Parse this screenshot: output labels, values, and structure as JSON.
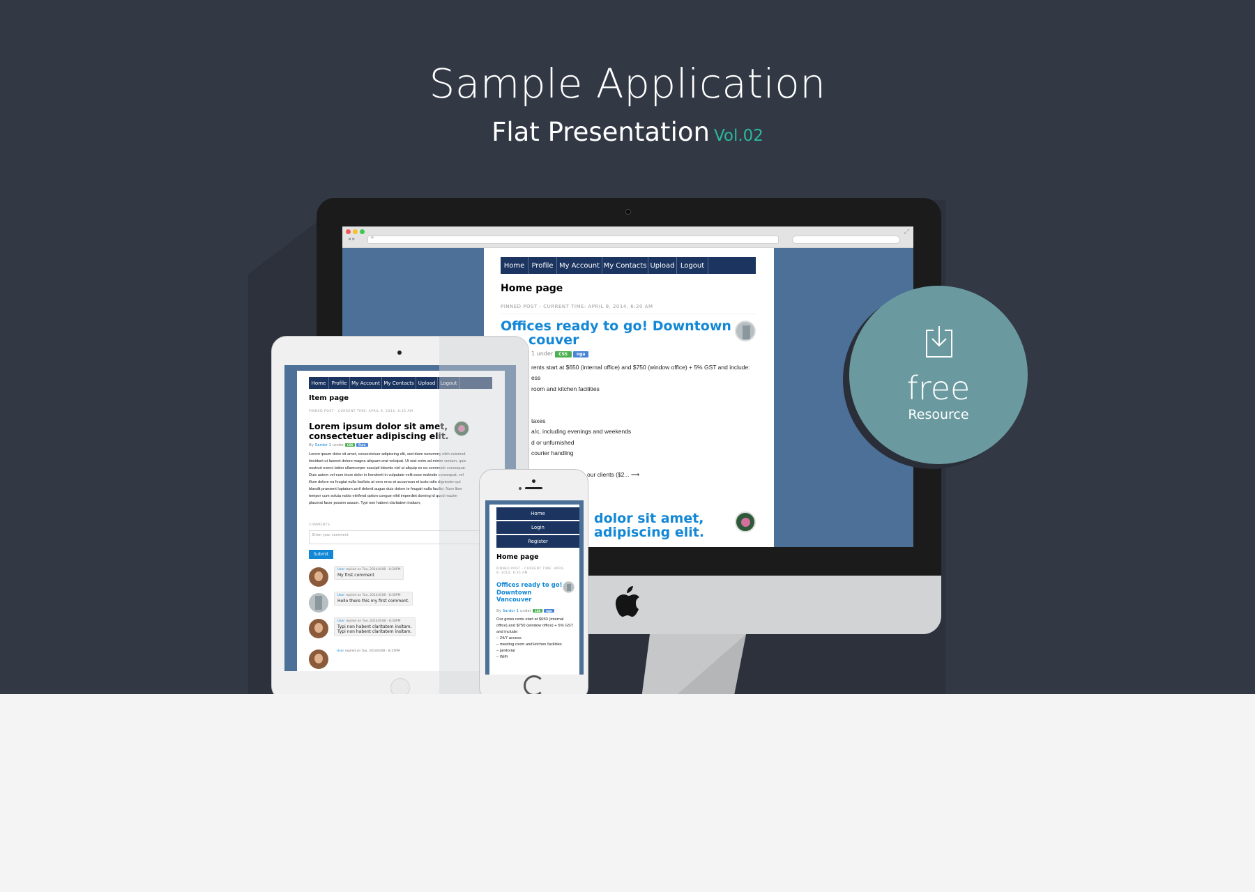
{
  "hero": {
    "title": "Sample Application",
    "subtitle": "Flat Presentation",
    "vol": "Vol.02"
  },
  "badge": {
    "free": "free",
    "resource": "Resource"
  },
  "desktop": {
    "nav": [
      "Home",
      "Profile",
      "My Account",
      "My Contacts",
      "Upload",
      "Logout"
    ],
    "page_title": "Home page",
    "meta": "PINNED POST - CURRENT TIME: APRIL 9, 2014, 6:20 AM",
    "post1": {
      "title_line1": "Offices ready to go! Downtown",
      "title_line2": "couver",
      "byline": "1 under",
      "tags": [
        "CSS",
        "nga"
      ],
      "lines": [
        "rents start at $650 (internal office) and $750 (window office) + 5% GST and include:",
        "ess",
        "room and kitchen facilities",
        "taxes",
        "a/c, including evenings and weekends",
        "d or unfurnished",
        "courier handling",
        "our clients ($2... ⟶"
      ]
    },
    "post2": {
      "title_line1": "dolor sit amet,",
      "title_line2": "adipiscing elit."
    }
  },
  "tablet": {
    "nav": [
      "Home",
      "Profile",
      "My Account",
      "My Contacts",
      "Upload",
      "Logout"
    ],
    "page_title": "Item page",
    "meta": "PINNED POST - CURRENT TIME: APRIL 9, 2014, 6:35 AM",
    "post_title_line1": "Lorem ipsum dolor sit amet,",
    "post_title_line2": "consectetuer adipiscing elit.",
    "byline_prefix": "By",
    "byline_author": "Sardor 1",
    "byline_suffix": "under",
    "tags": [
      "CSS",
      "Pure"
    ],
    "body_lines": [
      "Lorem ipsum dolor sit amet, consectetuer adipiscing elit, sed diam nonummy nibh euismod",
      "tincidunt ut laoreet dolore magna aliquam erat volutpat. Ut wisi enim ad minim veniam, quis",
      "nostrud exerci tation ullamcorper suscipit lobortis nisl ut aliquip ex ea commodo consequat.",
      "Duis autem vel eum iriure dolor in hendrerit in vulputate velit esse molestie consequat, vel",
      "illum dolore eu feugiat nulla facilisis at vero eros et accumsan et iusto odio dignissim qui",
      "blandit praesent luptatum zzril delenit augue duis dolore te feugait nulla facilisi. Nam liber",
      "tempor cum soluta nobis eleifend option congue nihil imperdiet doming id quod mazim",
      "placerat facer possim assum. Typi non habent claritatem insitam;"
    ],
    "comments_label": "COMMENTS",
    "comment_placeholder": "Enter your comment",
    "submit": "Submit",
    "comments": [
      {
        "user": "User",
        "time": "replied on Tue, 2014/4/08 - 8:28PM",
        "text": "My first comment"
      },
      {
        "user": "User",
        "time": "replied on Tue, 2014/4/08 - 8:30PM",
        "text": "Hello there this my first comment."
      },
      {
        "user": "User",
        "time": "replied on Tue, 2014/4/08 - 8:30PM",
        "text": "Typi non habent claritatem insitam.",
        "text2": "Typi non habent claritatem insitam."
      },
      {
        "user": "User",
        "time": "replied on Tue, 2014/4/08 - 8:31PM",
        "text": ""
      }
    ]
  },
  "phone": {
    "nav": [
      "Home",
      "Login",
      "Register"
    ],
    "page_title": "Home page",
    "meta_line1": "PINNED POST - CURRENT TIME: APRIL",
    "meta_line2": "9, 2014, 6:35 AM",
    "post_title": [
      "Offices ready to go!",
      "Downtown",
      "Vancouver"
    ],
    "byline_prefix": "By",
    "byline_author": "Sardor 1",
    "byline_suffix": "under",
    "tags": [
      "CSS",
      "nga"
    ],
    "body_lines": [
      "Our gross rents start at $650 (internal",
      "office) and $750 (window office) + 5% GST",
      "and include:",
      "– 24/7 access",
      "– meeting room and kitchen facilities",
      "– janitorial",
      "– WiFi"
    ]
  },
  "colors": {
    "background": "#333845",
    "floor": "#f4f4f4",
    "accent": "#2bb89c",
    "badge": "#6a9aa0",
    "nav": "#1b3560",
    "link": "#1287d6"
  }
}
